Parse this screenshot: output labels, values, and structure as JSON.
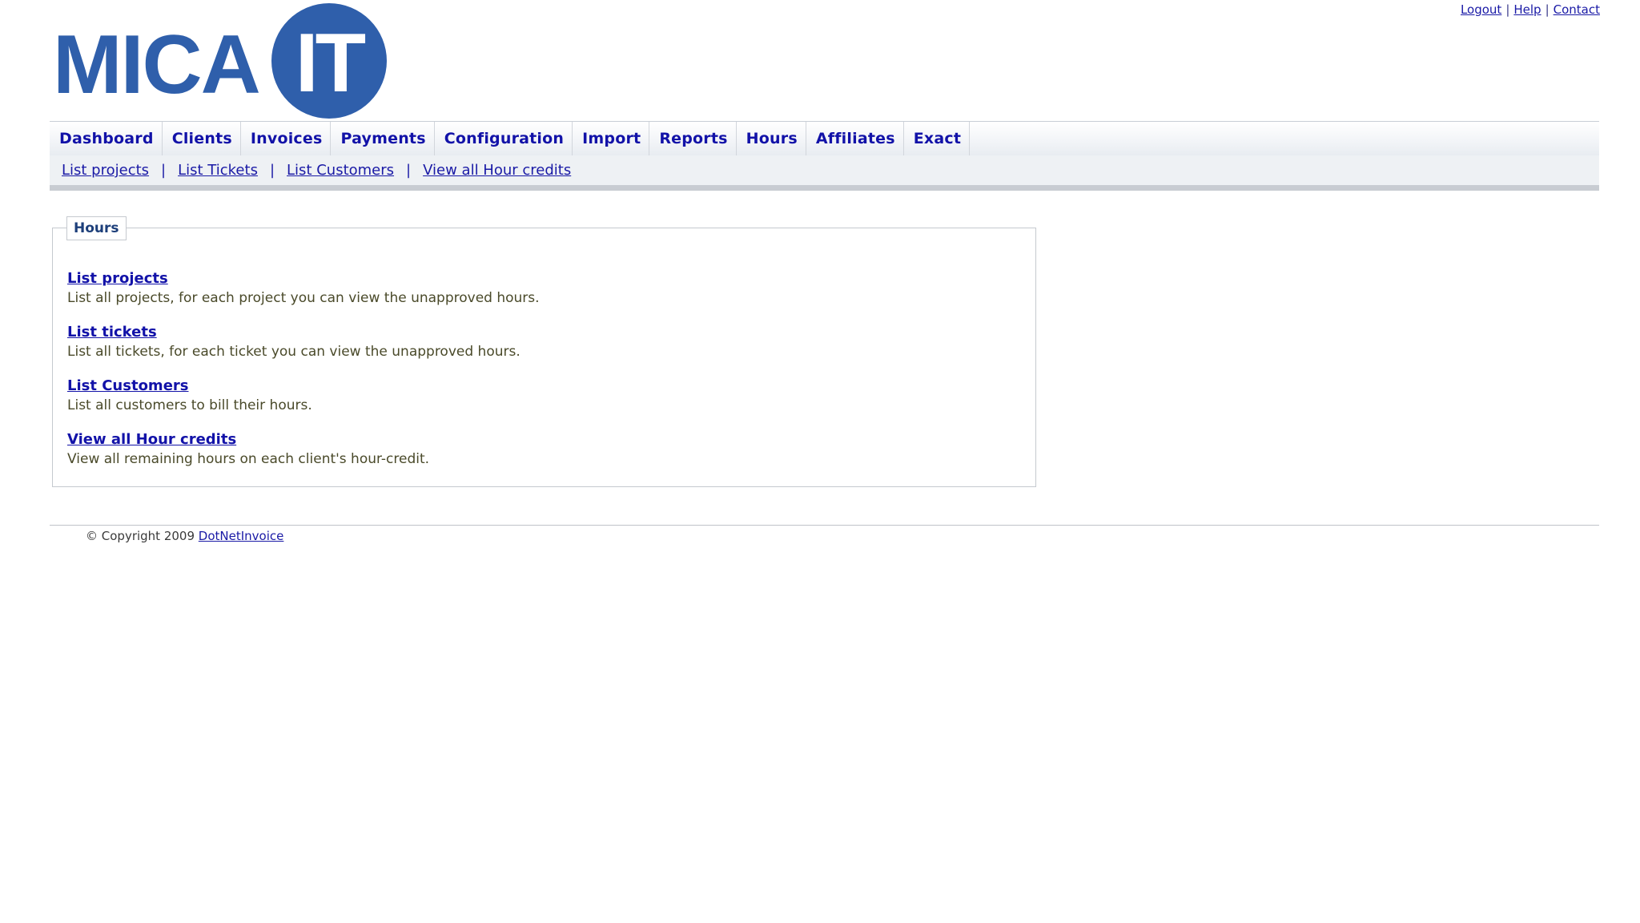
{
  "top_links": {
    "logout": "Logout",
    "help": "Help",
    "contact": "Contact",
    "separator": "|"
  },
  "logo": {
    "text_left": "MICA",
    "text_circle": "IT",
    "brand_color": "#2f5fab"
  },
  "main_nav": {
    "items": [
      {
        "label": "Dashboard"
      },
      {
        "label": "Clients"
      },
      {
        "label": "Invoices"
      },
      {
        "label": "Payments"
      },
      {
        "label": "Configuration"
      },
      {
        "label": "Import"
      },
      {
        "label": "Reports"
      },
      {
        "label": "Hours"
      },
      {
        "label": "Affiliates"
      },
      {
        "label": "Exact"
      }
    ]
  },
  "sub_nav": {
    "separator": "|",
    "items": [
      {
        "label": "List projects"
      },
      {
        "label": "List Tickets"
      },
      {
        "label": "List Customers"
      },
      {
        "label": "View all Hour credits"
      }
    ]
  },
  "hours_panel": {
    "legend": "Hours",
    "entries": [
      {
        "link": "List projects",
        "description": "List all projects, for each project you can view the unapproved hours."
      },
      {
        "link": "List tickets",
        "description": "List all tickets, for each ticket you can view the unapproved hours."
      },
      {
        "link": "List Customers",
        "description": "List all customers to bill their hours."
      },
      {
        "link": "View all Hour credits",
        "description": "View all remaining hours on each client's hour-credit."
      }
    ]
  },
  "footer": {
    "copyright": "© Copyright 2009",
    "link": "DotNetInvoice"
  },
  "colors": {
    "link": "#1212a8",
    "legend_text": "#1d3f7a",
    "description_text": "#4a4a2a"
  }
}
